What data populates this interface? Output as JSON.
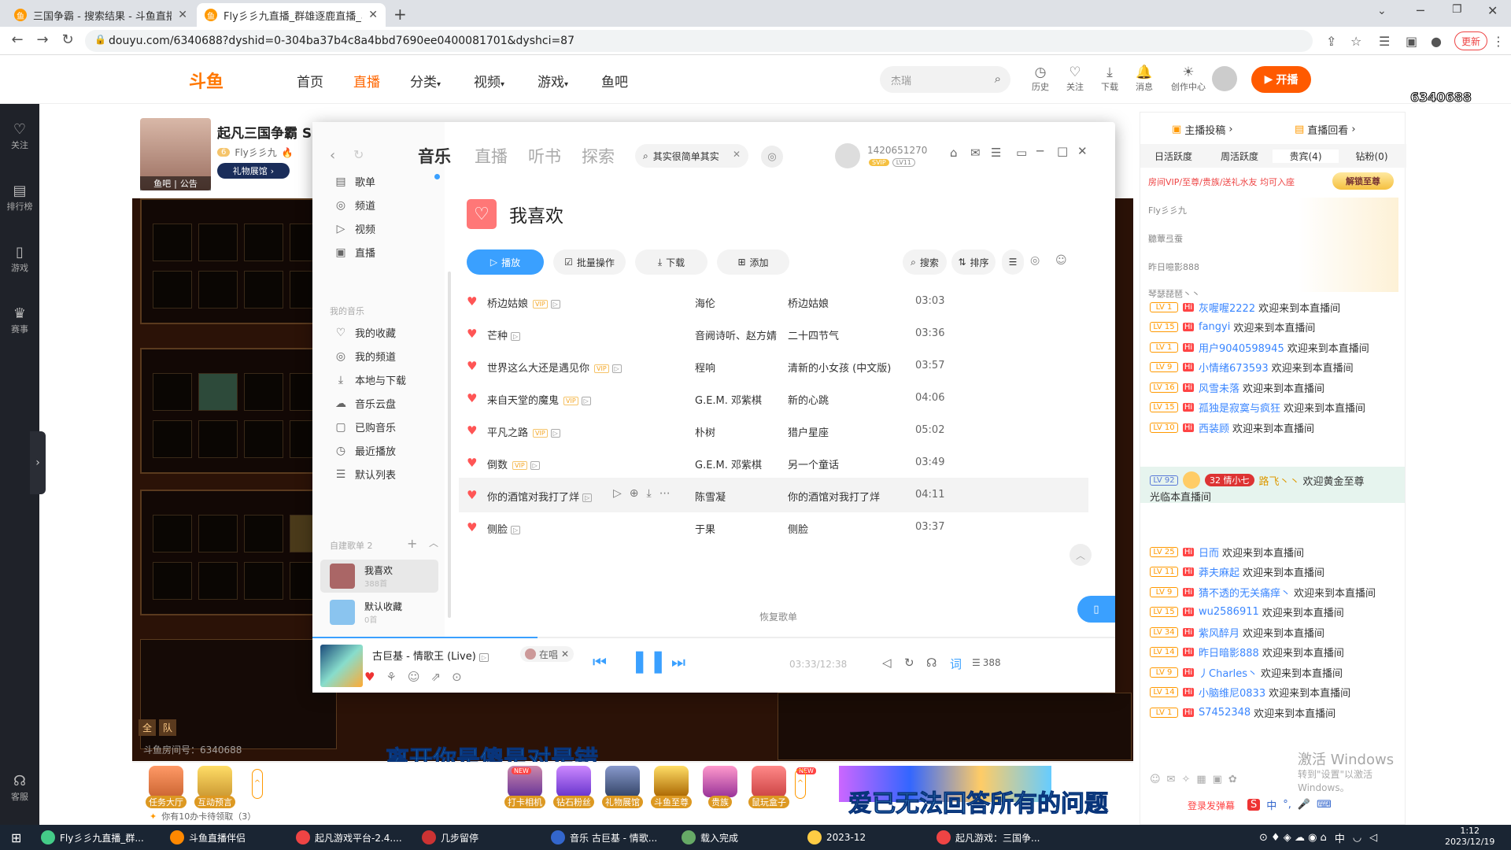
{
  "browser": {
    "tabs": [
      {
        "label": "三国争霸 - 搜索结果 - 斗鱼直播",
        "active": false
      },
      {
        "label": "Fly彡彡九直播_群雄逐鹿直播_斗…",
        "active": true
      }
    ],
    "url": "douyu.com/6340688?dyshid=0-304ba37b4c8a4bbd7690ee0400081701&dyshci=87",
    "profile_badge": "更新"
  },
  "douyu_header": {
    "nav": [
      "首页",
      "直播",
      "分类",
      "视频",
      "游戏",
      "鱼吧"
    ],
    "active_nav": "直播",
    "search_placeholder": "杰瑞",
    "icons": [
      {
        "label": "历史",
        "icon": "clock-icon"
      },
      {
        "label": "关注",
        "icon": "heart-icon"
      },
      {
        "label": "下载",
        "icon": "download-icon"
      },
      {
        "label": "消息",
        "icon": "bell-icon"
      },
      {
        "label": "创作中心",
        "icon": "bulb-icon"
      }
    ],
    "kaibo": "开播",
    "room_id_overlay": "6340688"
  },
  "left_sidebar": [
    {
      "label": "关注",
      "icon": "heart-icon"
    },
    {
      "label": "排行榜",
      "icon": "rank-icon"
    },
    {
      "label": "游戏",
      "icon": "game-icon"
    },
    {
      "label": "赛事",
      "icon": "trophy-icon"
    },
    {
      "label": "客服",
      "icon": "headset-icon"
    }
  ],
  "anchor": {
    "title": "起凡三国争霸 S",
    "level": "6",
    "name": "Fly彡彡九",
    "fishbar": "鱼吧",
    "notice": "公告",
    "gift_hall": "礼物展馆"
  },
  "game_overlay": {
    "room_num": "斗鱼房间号：6340688",
    "bottom_labels": [
      "全",
      "队"
    ]
  },
  "subtitles": {
    "line1": "离开你是傻是对是错",
    "line2": "爱已无法回答所有的问题"
  },
  "gift_bar": {
    "left_items": [
      "任务大厅",
      "互动预言"
    ],
    "gifts": [
      "打卡相机",
      "钻石粉丝",
      "礼物展馆",
      "斗鱼至尊",
      "贵族",
      "鼠玩盒子"
    ],
    "reward_text": "你有10办卡待领取（3）",
    "badges": [
      "NEW",
      "NEW"
    ]
  },
  "right_panel": {
    "top_buttons": [
      "主播投稿",
      "直播回看"
    ],
    "tabs": [
      "日活跃度",
      "周活跃度",
      "贵宾(4)",
      "钻粉(0)"
    ],
    "vip_notice": "房间VIP/至尊/贵族/送礼水友 均可入座",
    "unlock_btn": "解锁至尊",
    "vip_seats": [
      "Fly彡彡九",
      "聽蕈弖蚕",
      "昨日噫影888",
      "琴瑟琵琶丶丶"
    ],
    "chat": [
      {
        "lv": "LV 1",
        "user": "灰喔喔2222",
        "msg": "欢迎来到本直播间"
      },
      {
        "lv": "LV 15",
        "user": "fangyi",
        "msg": "欢迎来到本直播间"
      },
      {
        "lv": "LV 1",
        "user": "用户9040598945",
        "msg": "欢迎来到本直播间"
      },
      {
        "lv": "LV 9",
        "user": "小情绪673593",
        "msg": "欢迎来到本直播间"
      },
      {
        "lv": "LV 16",
        "user": "风雪未落",
        "msg": "欢迎来到本直播间"
      },
      {
        "lv": "LV 15",
        "user": "孤独是寂寞与疯狂",
        "msg": "欢迎来到本直播间"
      },
      {
        "lv": "LV 10",
        "user": "西装顾",
        "msg": "欢迎来到本直播间"
      }
    ],
    "special": {
      "lv": "LV 92",
      "fan_lv": "32",
      "fan_name": "情小七",
      "user": "路飞丶丶",
      "msg": "欢迎黄金至尊",
      "msg2": "光临本直播间"
    },
    "chat2": [
      {
        "lv": "LV 25",
        "user": "日而",
        "msg": "欢迎来到本直播间"
      },
      {
        "lv": "LV 11",
        "user": "莽夫麻起",
        "msg": "欢迎来到本直播间"
      },
      {
        "lv": "LV 9",
        "user": "猜不透的无关痛痒丶",
        "msg": "欢迎来到本直播间"
      },
      {
        "lv": "LV 15",
        "user": "wu2586911",
        "msg": "欢迎来到本直播间"
      },
      {
        "lv": "LV 34",
        "user": "紫风醉月",
        "msg": "欢迎来到本直播间"
      },
      {
        "lv": "LV 14",
        "user": "昨日暗影888",
        "msg": "欢迎来到本直播间"
      },
      {
        "lv": "LV 9",
        "user": "丿Charles丶",
        "msg": "欢迎来到本直播间"
      },
      {
        "lv": "LV 14",
        "user": "小脑维尼0833",
        "msg": "欢迎来到本直播间"
      },
      {
        "lv": "LV 1",
        "user": "S7452348",
        "msg": "欢迎来到本直播间"
      }
    ],
    "login_hint": "登录发弹幕",
    "activate_line1": "激活 Windows",
    "activate_line2": "转到\"设置\"以激活 Windows。"
  },
  "music": {
    "tabs": [
      "音乐",
      "直播",
      "听书",
      "探索"
    ],
    "active_tab": "音乐",
    "search_text": "其实很简单其实",
    "user_id": "1420651270",
    "user_badges": [
      "SVIP",
      "LV11"
    ],
    "sidebar": [
      {
        "label": "歌单",
        "icon": "list-icon"
      },
      {
        "label": "频道",
        "icon": "radio-icon"
      },
      {
        "label": "视频",
        "icon": "video-icon"
      },
      {
        "label": "直播",
        "icon": "live-icon"
      }
    ],
    "my_music_label": "我的音乐",
    "my_music": [
      {
        "label": "我的收藏",
        "icon": "heart-icon"
      },
      {
        "label": "我的频道",
        "icon": "radio-icon"
      },
      {
        "label": "本地与下载",
        "icon": "download-icon"
      },
      {
        "label": "音乐云盘",
        "icon": "cloud-icon"
      },
      {
        "label": "已购音乐",
        "icon": "bag-icon"
      },
      {
        "label": "最近播放",
        "icon": "clock-icon"
      },
      {
        "label": "默认列表",
        "icon": "queue-icon"
      }
    ],
    "created_label": "自建歌单 2",
    "playlists": [
      {
        "name": "我喜欢",
        "count": "388首"
      },
      {
        "name": "默认收藏",
        "count": "0首"
      }
    ],
    "playlist_title": "我喜欢",
    "toolbar": [
      "播放",
      "批量操作",
      "下载",
      "添加"
    ],
    "toolbar_right": [
      "搜索",
      "排序"
    ],
    "songs": [
      {
        "name": "桥边姑娘",
        "vip": true,
        "artist": "海伦",
        "album": "桥边姑娘",
        "duration": "03:03"
      },
      {
        "name": "芒种",
        "vip": false,
        "artist": "音阙诗听、赵方婧",
        "album": "二十四节气",
        "duration": "03:36"
      },
      {
        "name": "世界这么大还是遇见你",
        "vip": true,
        "artist": "程响",
        "album": "清新的小女孩 (中文版)",
        "duration": "03:57"
      },
      {
        "name": "来自天堂的魔鬼",
        "vip": true,
        "artist": "G.E.M. 邓紫棋",
        "album": "新的心跳",
        "duration": "04:06"
      },
      {
        "name": "平凡之路",
        "vip": true,
        "artist": "朴树",
        "album": "猎户星座",
        "duration": "05:02"
      },
      {
        "name": "倒数",
        "vip": true,
        "artist": "G.E.M. 邓紫棋",
        "album": "另一个童话",
        "duration": "03:49"
      },
      {
        "name": "你的酒馆对我打了烊",
        "vip": false,
        "artist": "陈雪凝",
        "album": "你的酒馆对我打了烊",
        "duration": "04:11"
      },
      {
        "name": "侧脸",
        "vip": false,
        "artist": "于果",
        "album": "侧脸",
        "duration": "03:37"
      }
    ],
    "restore_label": "恢复歌单",
    "player": {
      "track": "古巨基 - 情歌王 (Live)",
      "live_tag": "在唱",
      "time": "03:33/12:38",
      "progress": 0.28,
      "lyric_btn": "词",
      "queue_count": "388"
    }
  },
  "taskbar": {
    "items": [
      "Fly彡彡九直播_群...",
      "斗鱼直播伴侣",
      "起凡游戏平台-2.4....",
      "几步留停",
      "音乐 古巨基 - 情歌...",
      "载入完成",
      "2023-12",
      "起凡游戏：三国争..."
    ],
    "time": "1:12",
    "date": "2023/12/19",
    "ime": "中"
  },
  "colors": {
    "douyu_orange": "#ff5a00",
    "music_blue": "#3aa0ff",
    "heart_red": "#f55",
    "subtitle_blue": "#3ec6ff"
  }
}
